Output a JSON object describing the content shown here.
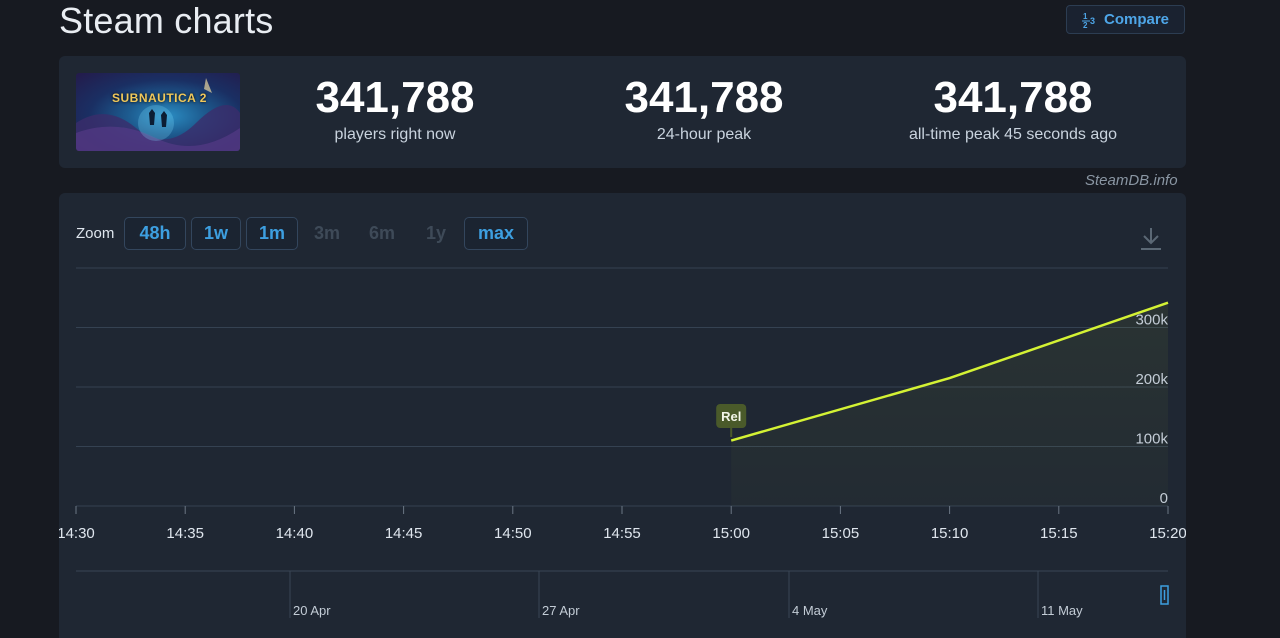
{
  "header": {
    "title": "Steam charts",
    "compare_label": "Compare"
  },
  "stats": {
    "game_logo_text": "SUBNAUTICA 2",
    "now_value": "341,788",
    "now_label": "players right now",
    "peak24_value": "341,788",
    "peak24_label": "24-hour peak",
    "alltime_value": "341,788",
    "alltime_label": "all-time peak 45 seconds ago"
  },
  "credit": "SteamDB.info",
  "zoom": {
    "label": "Zoom",
    "active": [
      "48h",
      "1w",
      "1m"
    ],
    "disabled": [
      "3m",
      "6m",
      "1y"
    ],
    "max": "max"
  },
  "colors": {
    "line": "#d4f234",
    "accent": "#3d9fe0",
    "marker_bg": "#4a5a2a"
  },
  "icons": {
    "download": "download-icon",
    "compare": "compare-icon"
  },
  "chart_data": {
    "type": "line",
    "title": "",
    "x": [
      "15:00",
      "15:10",
      "15:20"
    ],
    "series": [
      {
        "values": [
          110000,
          215000,
          341788
        ]
      }
    ],
    "x_ticks": [
      "14:30",
      "14:35",
      "14:40",
      "14:45",
      "14:50",
      "14:55",
      "15:00",
      "15:05",
      "15:10",
      "15:15",
      "15:20"
    ],
    "y_ticks": [
      "0",
      "100k",
      "200k",
      "300k"
    ],
    "ylim": [
      0,
      400000
    ],
    "annotations": [
      {
        "x": "15:00",
        "label": "Rel"
      }
    ],
    "navigator_ticks": [
      "20 Apr",
      "27 Apr",
      "4 May",
      "11 May"
    ],
    "grid": true
  }
}
